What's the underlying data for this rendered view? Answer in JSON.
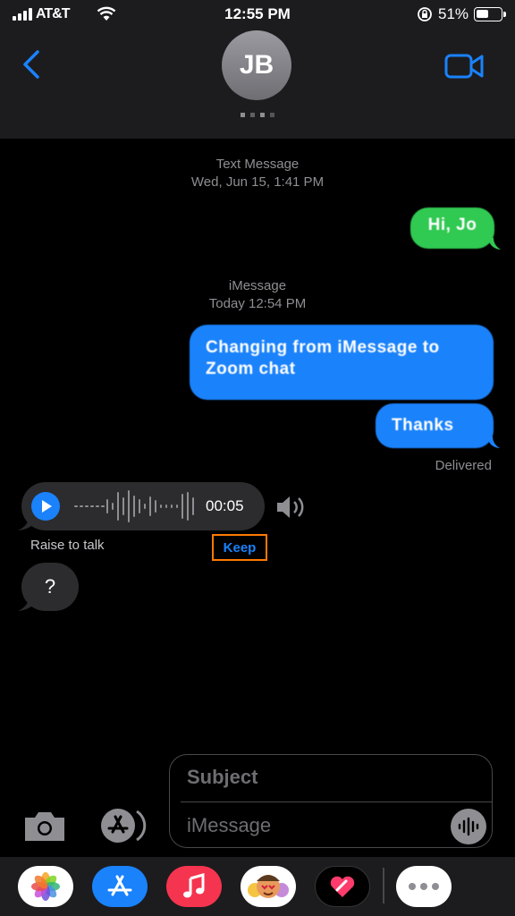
{
  "status_bar": {
    "carrier": "AT&T",
    "time": "12:55 PM",
    "battery_percent": "51%",
    "battery_level": 0.51
  },
  "header": {
    "avatar_initials": "JB",
    "back_icon": "chevron-left-icon",
    "video_icon": "video-camera-icon"
  },
  "thread": {
    "sms_label": "Text Message",
    "sms_date": "Wed, Jun 15, 1:41 PM",
    "sms_bubble": "Hi, Jo",
    "imessage_label": "iMessage",
    "imessage_date": "Today 12:54 PM",
    "blue_bubble_1": "Changing from iMessage to Zoom chat",
    "blue_bubble_2": "Thanks",
    "delivered": "Delivered",
    "audio_duration": "00:05",
    "raise_to_talk": "Raise to talk",
    "keep_label": "Keep",
    "question_bubble": "?"
  },
  "compose": {
    "subject_placeholder": "Subject",
    "message_placeholder": "iMessage"
  },
  "dock": {
    "apps": [
      "Photos",
      "App Store",
      "Music",
      "Memoji",
      "Digital Touch",
      "More"
    ]
  },
  "colors": {
    "imessage_blue": "#1a82fb",
    "sms_green": "#30c952",
    "keep_highlight": "#ff7a00"
  }
}
